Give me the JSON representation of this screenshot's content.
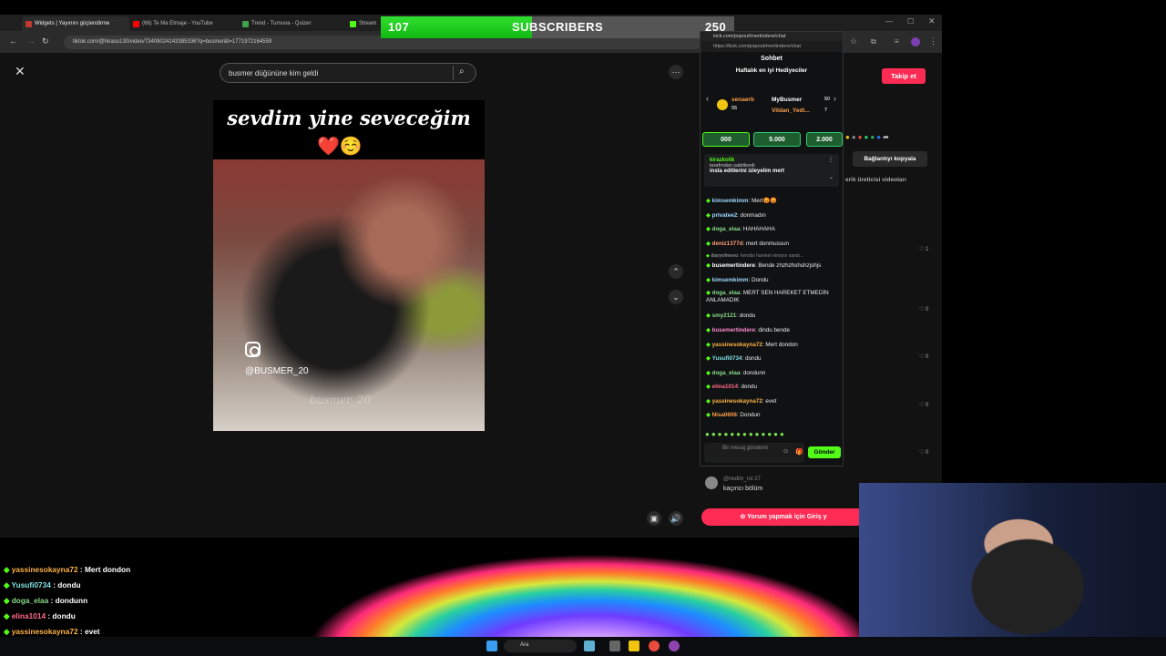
{
  "browser": {
    "tabs": [
      {
        "label": "Widgets | Yayınını güçlendirme",
        "color": "#c0392b"
      },
      {
        "label": "(66) Te Ma Etmaje - YouTube",
        "color": "#ff0000"
      },
      {
        "label": "Trend - Turnuva - Quizer",
        "color": "#3fa34d"
      },
      {
        "label": "Stream",
        "color": "#53fc18"
      }
    ],
    "url": "tiktok.com/@hirasu130/video/73409024243385336?q=busmer&t=1771972164559"
  },
  "subscribers": {
    "current": "107",
    "label": "SUBSCRIBERS",
    "goal": "250",
    "progress": 0.428
  },
  "tiktok": {
    "search_value": "busmer düğününe kim geldi",
    "caption": "sevdim yine seveceğim",
    "emoji": "❤️☺️",
    "handle": "@BUSMER_20",
    "watermark": "busmer_20",
    "follow_label": "Takip et",
    "copy_link_label": "Bağlantıyı kopyala",
    "creator_videos_label": "erik üreticisi videoları",
    "likes": [
      "1",
      "0",
      "0",
      "0",
      "0"
    ],
    "comment": {
      "user": "@nedim_rst 27",
      "text": "kaçıncı bölüm"
    },
    "comment_cta": "Yorum yapmak için Giriş y"
  },
  "kick_chat": {
    "window_title": "kick.com/popout/mertindere/chat",
    "url": "https://kick.com/popout/mertindere/chat",
    "header": "Sohbet",
    "gifters_title": "Haftalık en iyi Hediyeciler",
    "gifters": [
      {
        "name": "senaerb",
        "amount": "55"
      },
      {
        "name": "MyBusmer",
        "amount": "50"
      },
      {
        "name": "Vildan_Yedi...",
        "amount": "7"
      }
    ],
    "kicks": [
      "000",
      "5.000",
      "2.000"
    ],
    "pinned": {
      "user": "kirazkolik",
      "by": "tarafından sabitlendi",
      "text": "insta editlerini izleyelim mert"
    },
    "messages": [
      {
        "user": "kimsemkimm",
        "text": "Mert😡😡",
        "color": "#9fd7ff"
      },
      {
        "user": "privatee2",
        "text": "donmadın",
        "color": "#9fd7ff"
      },
      {
        "user": "doga_elaa",
        "text": "HAHAHAHA",
        "color": "#8ad98a"
      },
      {
        "user": "deniz1377d",
        "text": "mert donmussun",
        "color": "#ff9f7a"
      },
      {
        "user": "diaryofmeno",
        "text": "kendisi hareket etmiyor sandı...",
        "color": "#888"
      },
      {
        "user": "busemertindere",
        "text": "Bende zhzhzhshshzjshjs",
        "color": "#ffffff"
      },
      {
        "user": "kimsemkimm",
        "text": "Dondu",
        "color": "#9fd7ff"
      },
      {
        "user": "doga_elaa",
        "text": "MERT SEN HAREKET ETMEDİN ANLAMADIK",
        "color": "#8ad98a"
      },
      {
        "user": "smy2121",
        "text": "dondu",
        "color": "#8ad98a"
      },
      {
        "user": "busemertindere",
        "text": "dindu bende",
        "color": "#ff8ad0"
      },
      {
        "user": "yassinesokayna72",
        "text": "Mert dondon",
        "color": "#ffb347"
      },
      {
        "user": "Yusufi0734",
        "text": "dondu",
        "color": "#7ee0e0"
      },
      {
        "user": "doga_elaa",
        "text": "dondunn",
        "color": "#8ad98a"
      },
      {
        "user": "elina1014",
        "text": "dondu",
        "color": "#ff6b8a"
      },
      {
        "user": "yassinesokayna72",
        "text": "evet",
        "color": "#ffb347"
      },
      {
        "user": "Nisa0606",
        "text": "Dondun",
        "color": "#ff9f4a"
      }
    ],
    "input_placeholder": "Bir mesaj gönderin",
    "send_label": "Gönder"
  },
  "overlay_chat": [
    {
      "user": "yassinesokayna72",
      "text": "Mert dondon",
      "color": "#ffb347"
    },
    {
      "user": "Yusufi0734",
      "text": "dondu",
      "color": "#7ee0e0"
    },
    {
      "user": "doga_elaa",
      "text": "dondunn",
      "color": "#8ad98a"
    },
    {
      "user": "elina1014",
      "text": "dondu",
      "color": "#ff6b8a"
    },
    {
      "user": "yassinesokayna72",
      "text": "evet",
      "color": "#ffb347"
    },
    {
      "user": "Nisa0606",
      "text": "Dondun",
      "color": "#ff9f4a"
    }
  ],
  "taskbar": {
    "search_placeholder": "Ara"
  }
}
